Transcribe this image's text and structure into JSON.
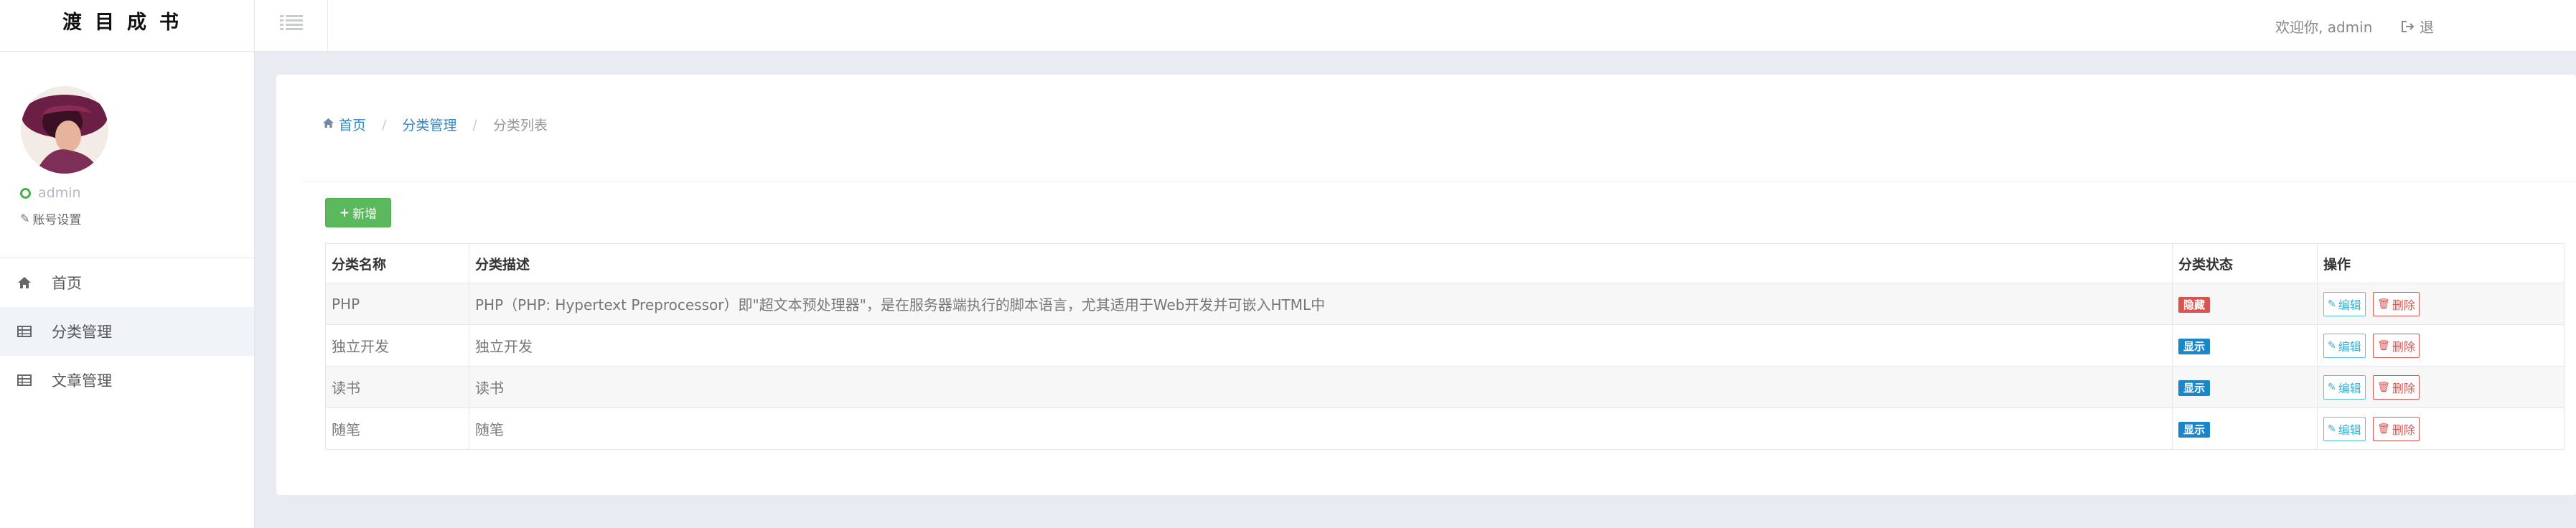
{
  "brand": {
    "title": "渡目成书"
  },
  "user": {
    "name": "admin",
    "account_settings": "账号设置"
  },
  "sidebar": {
    "items": [
      {
        "label": "首页",
        "icon": "home-icon",
        "active": false
      },
      {
        "label": "分类管理",
        "icon": "table-icon",
        "active": true
      },
      {
        "label": "文章管理",
        "icon": "table-icon",
        "active": false
      }
    ]
  },
  "topbar": {
    "welcome": "欢迎你, admin",
    "logout": "退"
  },
  "breadcrumb": {
    "home": "首页",
    "category": "分类管理",
    "current": "分类列表"
  },
  "toolbar": {
    "add_label": "新增"
  },
  "table": {
    "headers": {
      "name": "分类名称",
      "desc": "分类描述",
      "state": "分类状态",
      "op": "操作"
    },
    "rows": [
      {
        "name": "PHP",
        "desc": "PHP（PHP: Hypertext Preprocessor）即\"超文本预处理器\"，是在服务器端执行的脚本语言，尤其适用于Web开发并可嵌入HTML中",
        "state": "隐藏",
        "state_color": "#d9534f",
        "edit": "编辑",
        "del": "删除"
      },
      {
        "name": "独立开发",
        "desc": "独立开发",
        "state": "显示",
        "state_color": "#1b87c9",
        "edit": "编辑",
        "del": "删除"
      },
      {
        "name": "读书",
        "desc": "读书",
        "state": "显示",
        "state_color": "#1b87c9",
        "edit": "编辑",
        "del": "删除"
      },
      {
        "name": "随笔",
        "desc": "随笔",
        "state": "显示",
        "state_color": "#1b87c9",
        "edit": "编辑",
        "del": "删除"
      }
    ]
  },
  "colors": {
    "accent": "#3087c8",
    "success": "#5cb85c",
    "danger": "#d9534f",
    "info": "#5bc0de"
  }
}
